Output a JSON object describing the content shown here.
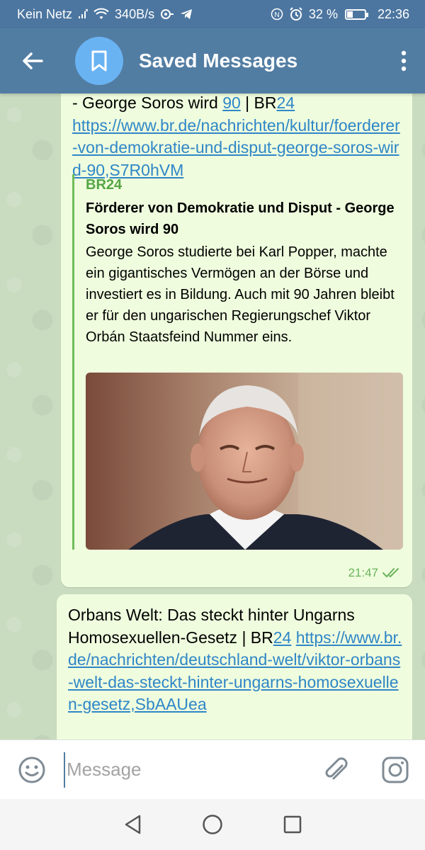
{
  "status_bar": {
    "network": "Kein Netz",
    "speed": "340B/s",
    "battery_percent": "32 %",
    "battery_level": 0.32,
    "time": "22:36"
  },
  "app_bar": {
    "title": "Saved Messages"
  },
  "messages": [
    {
      "text_prefix": "- George Soros wird ",
      "text_link_num": "90",
      "text_mid": " | BR",
      "text_link_br": "24",
      "url": "https://www.br.de/nachrichten/kultur/foerderer-von-demokratie-und-disput-george-soros-wird-90,S7R0hVM",
      "preview": {
        "site": "BR24",
        "title": "Förderer von Demokratie und Disput - George Soros wird 90",
        "description": "George Soros studierte bei Karl Popper, machte ein gigantisches Vermögen an der Börse und investiert es in Bildung. Auch mit 90 Jahren bleibt er für den ungarischen Regierungschef Viktor Orbán Staatsfeind Nummer eins."
      },
      "time": "21:47"
    },
    {
      "text_prefix": "Orbans Welt: Das steckt hinter Ungarns Homosexuellen-Gesetz | BR",
      "text_link_br": "24",
      "url": "https://www.br.de/nachrichten/deutschland-welt/viktor-orbans-welt-das-steckt-hinter-ungarns-homosexuellen-gesetz,SbAAUea"
    }
  ],
  "input": {
    "placeholder": "Message"
  },
  "icons": {
    "back": "arrow-left-icon",
    "avatar": "bookmark-icon",
    "menu": "more-vertical-icon",
    "emoji": "smiley-icon",
    "attach": "paperclip-icon",
    "camera": "camera-icon",
    "nav_back": "triangle-back-icon",
    "nav_home": "circle-home-icon",
    "nav_recent": "square-recent-icon"
  },
  "colors": {
    "header": "#527da3",
    "status_bar": "#4c76a0",
    "bubble": "#effdde",
    "link": "#2f86c7",
    "accent_green": "#6fbb5a"
  }
}
